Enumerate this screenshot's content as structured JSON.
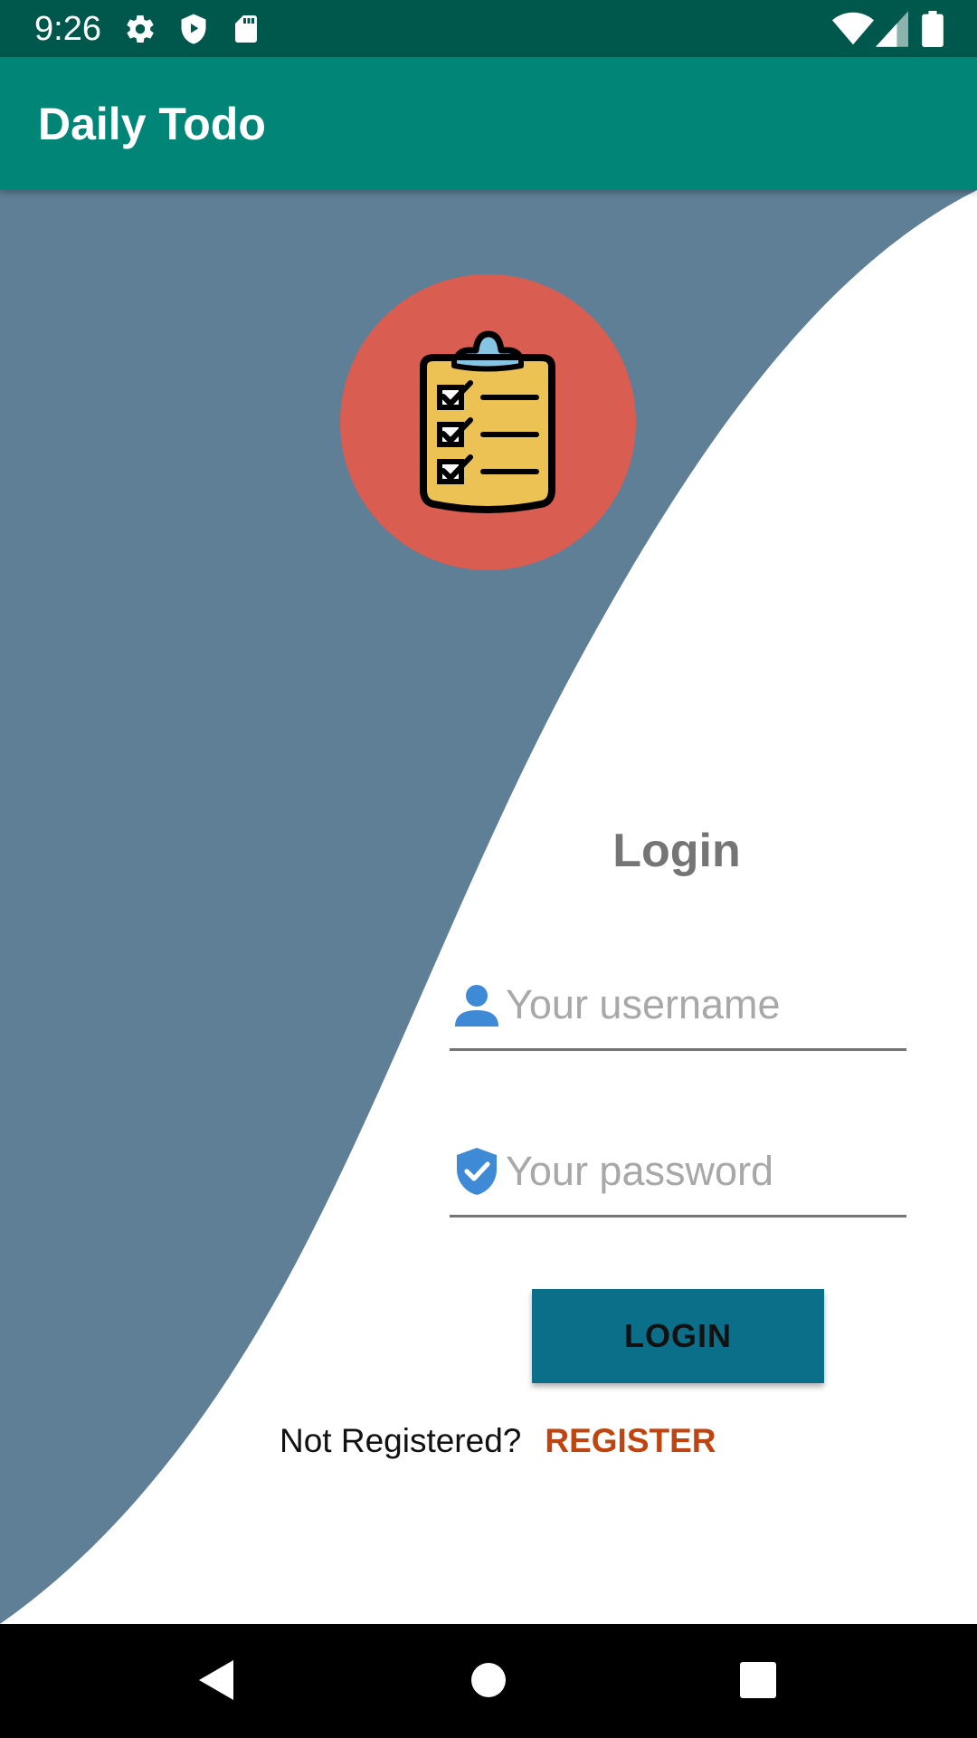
{
  "status_bar": {
    "time": "9:26",
    "left_icons": [
      "gear-icon",
      "shield-play-icon",
      "sd-card-icon"
    ],
    "right_icons": [
      "wifi-icon",
      "signal-icon",
      "battery-icon"
    ]
  },
  "app_bar": {
    "title": "Daily Todo"
  },
  "logo": {
    "icon": "clipboard-checklist-icon",
    "circle_color": "#d95d51"
  },
  "login_form": {
    "title": "Login",
    "username": {
      "icon": "person-icon",
      "placeholder": "Your username",
      "value": ""
    },
    "password": {
      "icon": "shield-check-icon",
      "placeholder": "Your password",
      "value": ""
    },
    "login_button_label": "LOGIN",
    "register_prompt": "Not Registered?",
    "register_link_label": "REGISTER"
  },
  "nav_bar": {
    "buttons": [
      "back-icon",
      "home-icon",
      "recents-icon"
    ]
  },
  "colors": {
    "status_bar": "#00574b",
    "app_bar": "#008577",
    "wave": "#5e7f95",
    "login_button": "#0c6f89",
    "register_link": "#c0440f",
    "input_icon": "#3f8ad6"
  }
}
